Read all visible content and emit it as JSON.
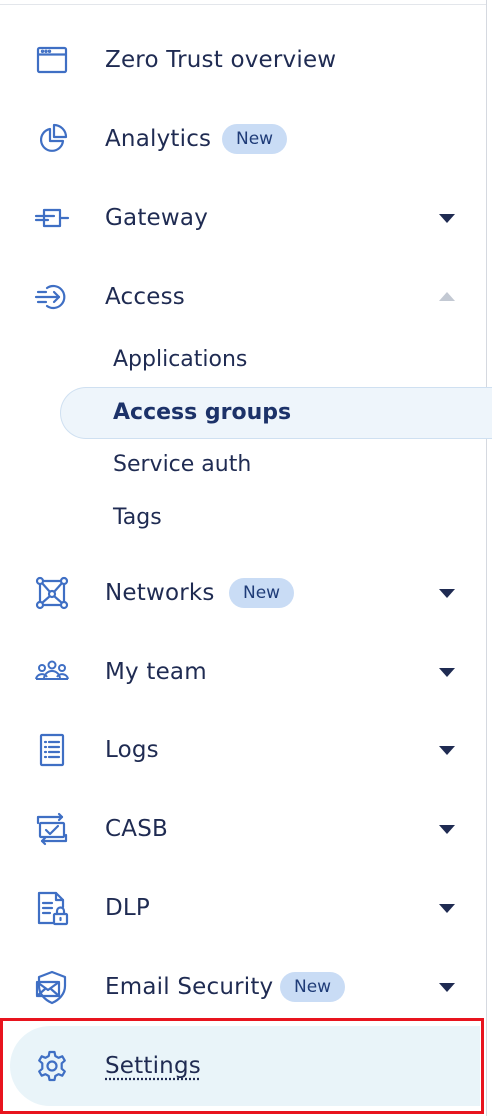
{
  "nav": {
    "zero_trust_overview": {
      "label": "Zero Trust overview",
      "icon": "browser-window-icon"
    },
    "analytics": {
      "label": "Analytics",
      "badge": "New",
      "icon": "pie-chart-icon"
    },
    "gateway": {
      "label": "Gateway",
      "icon": "gateway-icon"
    },
    "access": {
      "label": "Access",
      "icon": "sign-in-arrow-icon",
      "expanded": true,
      "items": [
        "Applications",
        "Access groups",
        "Service auth",
        "Tags"
      ],
      "active_item": "Access groups"
    },
    "networks": {
      "label": "Networks",
      "badge": "New",
      "icon": "network-nodes-icon"
    },
    "my_team": {
      "label": "My team",
      "icon": "team-icon"
    },
    "logs": {
      "label": "Logs",
      "icon": "log-document-icon"
    },
    "casb": {
      "label": "CASB",
      "icon": "casb-check-icon"
    },
    "dlp": {
      "label": "DLP",
      "icon": "document-lock-icon"
    },
    "email_security": {
      "label": "Email Security",
      "badge": "New",
      "icon": "mail-shield-icon"
    },
    "settings": {
      "label": "Settings",
      "icon": "gear-icon"
    }
  },
  "colors": {
    "text": "#1f2b52",
    "icon": "#3f6fc4",
    "badge_bg": "#c9dcf5",
    "active_bg": "#eef5fb",
    "settings_bg": "#e9f4f9",
    "highlight_border": "#e8141e"
  }
}
